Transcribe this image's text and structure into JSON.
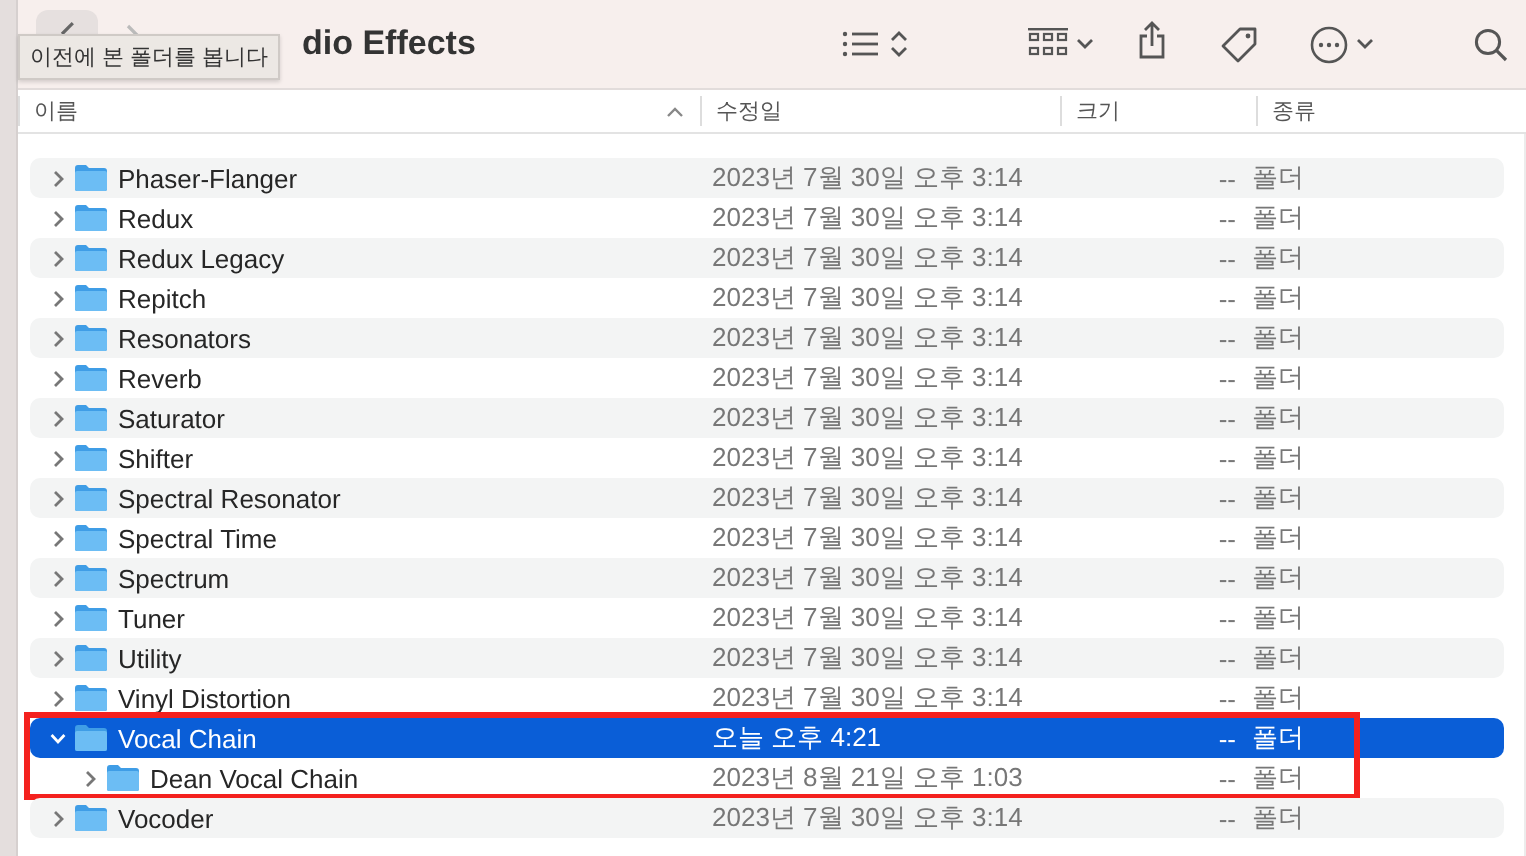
{
  "window": {
    "title": "dio Effects"
  },
  "tooltip": {
    "text": "이전에 본 폴더를 봅니다"
  },
  "columns": [
    {
      "label": "이름",
      "sorted": true
    },
    {
      "label": "수정일",
      "sorted": false
    },
    {
      "label": "크기",
      "sorted": false
    },
    {
      "label": "종류",
      "sorted": false
    }
  ],
  "rows": [
    {
      "name": "Phaser-Flanger",
      "modified": "2023년 7월 30일 오후 3:14",
      "size": "--",
      "kind": "폴더",
      "expanded": false,
      "selected": false,
      "outlined": false
    },
    {
      "name": "Redux",
      "modified": "2023년 7월 30일 오후 3:14",
      "size": "--",
      "kind": "폴더",
      "expanded": false,
      "selected": false,
      "outlined": false
    },
    {
      "name": "Redux Legacy",
      "modified": "2023년 7월 30일 오후 3:14",
      "size": "--",
      "kind": "폴더",
      "expanded": false,
      "selected": false,
      "outlined": false
    },
    {
      "name": "Repitch",
      "modified": "2023년 7월 30일 오후 3:14",
      "size": "--",
      "kind": "폴더",
      "expanded": false,
      "selected": false,
      "outlined": false
    },
    {
      "name": "Resonators",
      "modified": "2023년 7월 30일 오후 3:14",
      "size": "--",
      "kind": "폴더",
      "expanded": false,
      "selected": false,
      "outlined": false
    },
    {
      "name": "Reverb",
      "modified": "2023년 7월 30일 오후 3:14",
      "size": "--",
      "kind": "폴더",
      "expanded": false,
      "selected": false,
      "outlined": false
    },
    {
      "name": "Saturator",
      "modified": "2023년 7월 30일 오후 3:14",
      "size": "--",
      "kind": "폴더",
      "expanded": false,
      "selected": false,
      "outlined": false
    },
    {
      "name": "Shifter",
      "modified": "2023년 7월 30일 오후 3:14",
      "size": "--",
      "kind": "폴더",
      "expanded": false,
      "selected": false,
      "outlined": false
    },
    {
      "name": "Spectral Resonator",
      "modified": "2023년 7월 30일 오후 3:14",
      "size": "--",
      "kind": "폴더",
      "expanded": false,
      "selected": false,
      "outlined": false
    },
    {
      "name": "Spectral Time",
      "modified": "2023년 7월 30일 오후 3:14",
      "size": "--",
      "kind": "폴더",
      "expanded": false,
      "selected": false,
      "outlined": false
    },
    {
      "name": "Spectrum",
      "modified": "2023년 7월 30일 오후 3:14",
      "size": "--",
      "kind": "폴더",
      "expanded": false,
      "selected": false,
      "outlined": false
    },
    {
      "name": "Tuner",
      "modified": "2023년 7월 30일 오후 3:14",
      "size": "--",
      "kind": "폴더",
      "expanded": false,
      "selected": false,
      "outlined": false
    },
    {
      "name": "Utility",
      "modified": "2023년 7월 30일 오후 3:14",
      "size": "--",
      "kind": "폴더",
      "expanded": false,
      "selected": false,
      "outlined": false
    },
    {
      "name": "Vinyl Distortion",
      "modified": "2023년 7월 30일 오후 3:14",
      "size": "--",
      "kind": "폴더",
      "expanded": false,
      "selected": false,
      "outlined": false
    },
    {
      "name": "Vocal Chain",
      "modified": "오늘 오후 4:21",
      "size": "--",
      "kind": "폴더",
      "expanded": true,
      "selected": true,
      "outlined": true,
      "children": [
        {
          "name": "Dean Vocal Chain",
          "modified": "2023년 8월 21일 오후 1:03",
          "size": "--",
          "kind": "폴더",
          "expanded": false,
          "selected": false,
          "outlined": false
        }
      ]
    },
    {
      "name": "Vocoder",
      "modified": "2023년 7월 30일 오후 3:14",
      "size": "--",
      "kind": "폴더",
      "expanded": false,
      "selected": false,
      "outlined": false
    }
  ]
}
